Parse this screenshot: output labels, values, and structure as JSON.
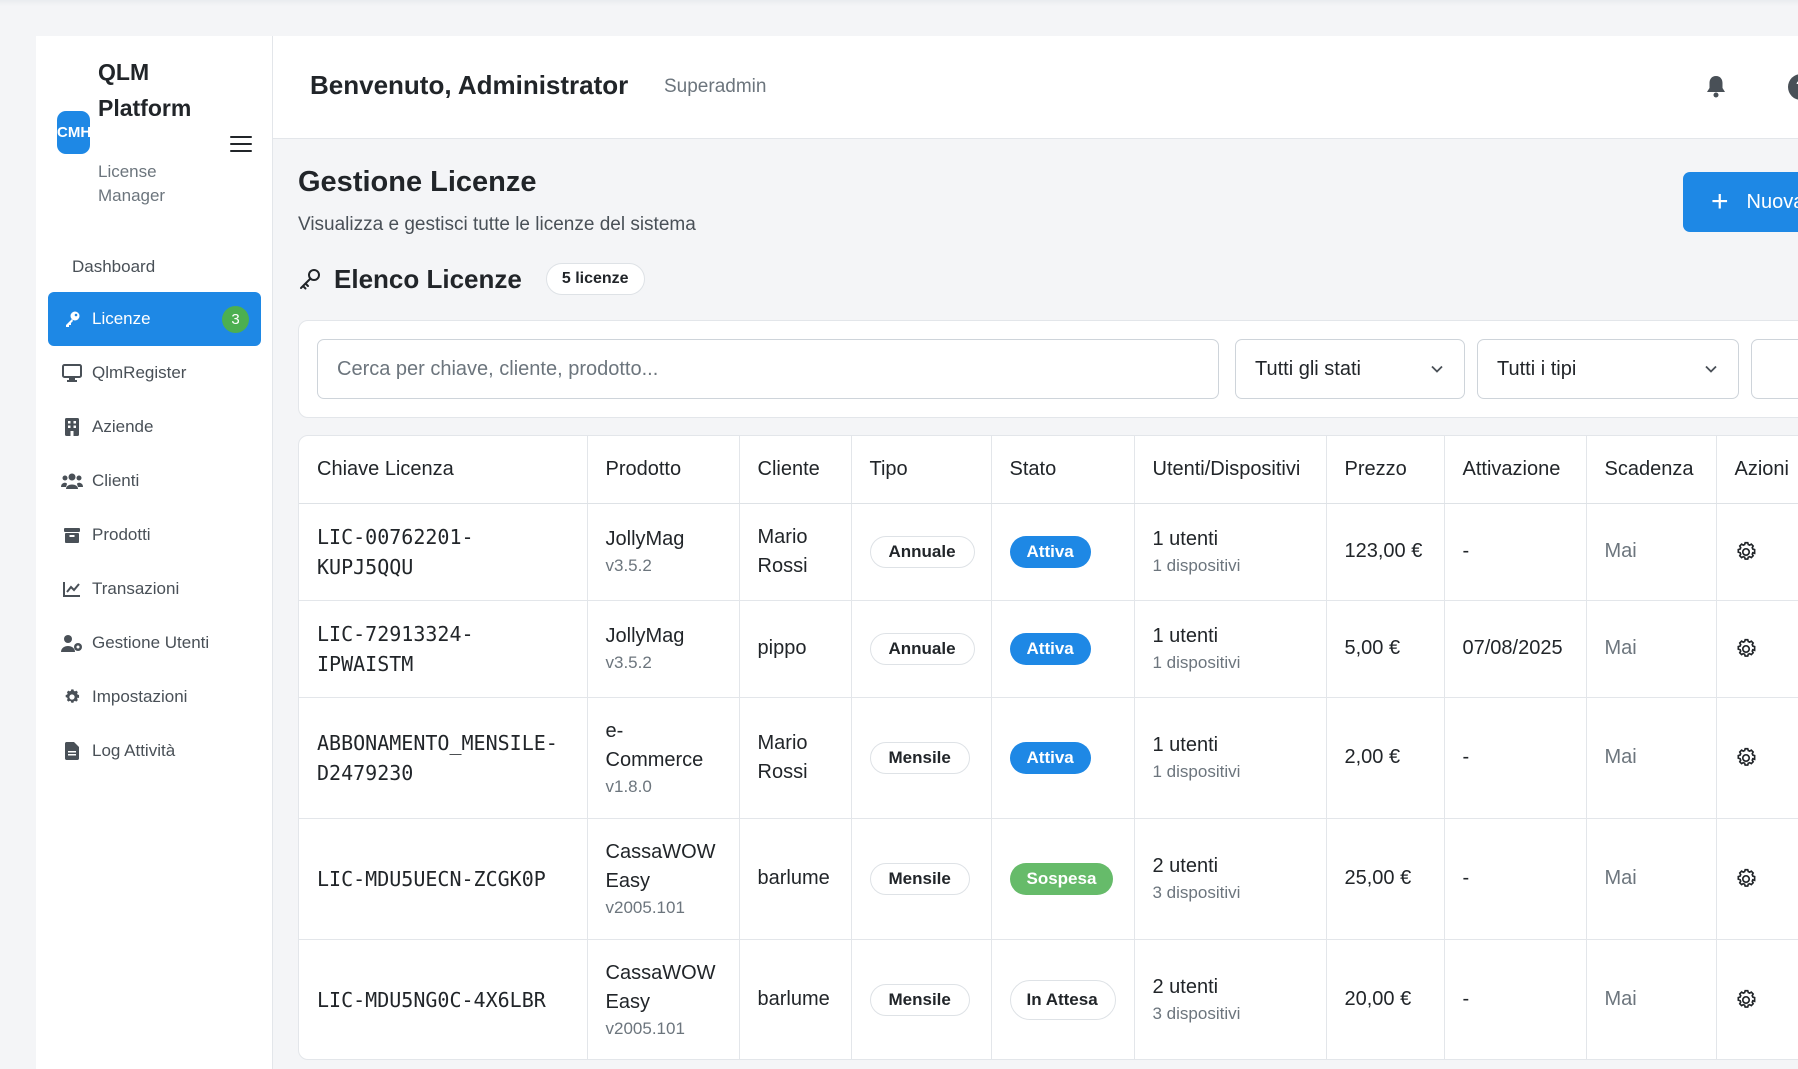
{
  "brand": {
    "logo_text": "CMH",
    "title": "QLM Platform",
    "subtitle": "License Manager"
  },
  "sidebar": {
    "items": [
      {
        "label": "Dashboard",
        "icon": "none"
      },
      {
        "label": "Licenze",
        "icon": "key-icon",
        "badge": "3",
        "active": true
      },
      {
        "label": "QlmRegister",
        "icon": "monitor-icon"
      },
      {
        "label": "Aziende",
        "icon": "building-icon"
      },
      {
        "label": "Clienti",
        "icon": "users-icon"
      },
      {
        "label": "Prodotti",
        "icon": "box-icon"
      },
      {
        "label": "Transazioni",
        "icon": "chart-line-icon"
      },
      {
        "label": "Gestione Utenti",
        "icon": "user-cog-icon"
      },
      {
        "label": "Impostazioni",
        "icon": "gear-icon"
      },
      {
        "label": "Log Attività",
        "icon": "file-icon"
      }
    ]
  },
  "header": {
    "welcome": "Benvenuto, Administrator",
    "role": "Superadmin"
  },
  "main": {
    "title": "Gestione Licenze",
    "subtitle": "Visualizza e gestisci tutte le licenze del sistema",
    "new_button": "Nuova",
    "list_title": "Elenco Licenze",
    "count": "5 licenze"
  },
  "filters": {
    "search_placeholder": "Cerca per chiave, cliente, prodotto...",
    "status_select": "Tutti gli stati",
    "type_select": "Tutti i tipi"
  },
  "table": {
    "columns": [
      "Chiave Licenza",
      "Prodotto",
      "Cliente",
      "Tipo",
      "Stato",
      "Utenti/Dispositivi",
      "Prezzo",
      "Attivazione",
      "Scadenza",
      "Azioni"
    ],
    "rows": [
      {
        "key": "LIC-00762201-KUPJ5QQU",
        "product": "JollyMag",
        "version": "v3.5.2",
        "client": "Mario Rossi",
        "type": "Annuale",
        "status": "Attiva",
        "users": "1 utenti",
        "devices": "1 dispositivi",
        "price": "123,00 €",
        "activation": "-",
        "expiry": "Mai"
      },
      {
        "key": "LIC-72913324-IPWAISTM",
        "product": "JollyMag",
        "version": "v3.5.2",
        "client": "pippo",
        "type": "Annuale",
        "status": "Attiva",
        "users": "1 utenti",
        "devices": "1 dispositivi",
        "price": "5,00 €",
        "activation": "07/08/2025",
        "expiry": "Mai"
      },
      {
        "key": "ABBONAMENTO_MENSILE-D2479230",
        "product": "e-Commerce",
        "version": "v1.8.0",
        "client": "Mario Rossi",
        "type": "Mensile",
        "status": "Attiva",
        "users": "1 utenti",
        "devices": "1 dispositivi",
        "price": "2,00 €",
        "activation": "-",
        "expiry": "Mai"
      },
      {
        "key": "LIC-MDU5UECN-ZCGK0P",
        "product": "CassaWOW Easy",
        "version": "v2005.101",
        "client": "barlume",
        "type": "Mensile",
        "status": "Sospesa",
        "users": "2 utenti",
        "devices": "3 dispositivi",
        "price": "25,00 €",
        "activation": "-",
        "expiry": "Mai"
      },
      {
        "key": "LIC-MDU5NG0C-4X6LBR",
        "product": "CassaWOW Easy",
        "version": "v2005.101",
        "client": "barlume",
        "type": "Mensile",
        "status": "In Attesa",
        "users": "2 utenti",
        "devices": "3 dispositivi",
        "price": "20,00 €",
        "activation": "-",
        "expiry": "Mai"
      }
    ]
  },
  "colors": {
    "primary": "#1e88e5",
    "success": "#4caf50",
    "suspended": "#66bb6a",
    "badge": "#4caf50"
  }
}
